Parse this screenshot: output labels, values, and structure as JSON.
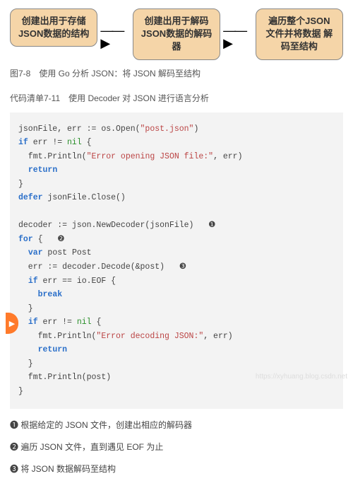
{
  "diagram": {
    "box1": "创建出用于存储\nJSON数据的结构",
    "box2": "创建出用于解码\nJSON数据的解码器",
    "box3": "遍历整个JSON\n文件并将数据\n解码至结构"
  },
  "caption": "图7-8　使用 Go 分析 JSON：将 JSON 解码至结构",
  "listing_title": "代码清单7-11　使用 Decoder 对 JSON 进行语言分析",
  "code": {
    "l1a": "jsonFile, err := os.Open(",
    "l1b": "\"post.json\"",
    "l1c": ")",
    "l2a": "if",
    "l2b": " err != ",
    "l2c": "nil",
    "l2d": " {",
    "l3a": "  fmt.Println(",
    "l3b": "\"Error opening JSON file:\"",
    "l3c": ", err)",
    "l4a": "  ",
    "l4b": "return",
    "l5": "}",
    "l6a": "defer",
    "l6b": " jsonFile.Close()",
    "blank1": "",
    "l7": "decoder := json.NewDecoder(jsonFile)   ❶",
    "l8a": "for",
    "l8b": " {   ❷",
    "l9a": "  ",
    "l9b": "var",
    "l9c": " post Post",
    "l10": "  err := decoder.Decode(&post)   ❸",
    "l11a": "  ",
    "l11b": "if",
    "l11c": " err == io.EOF {",
    "l12a": "    ",
    "l12b": "break",
    "l13": "  }",
    "l14a": "  ",
    "l14b": "if",
    "l14c": " err != ",
    "l14d": "nil",
    "l14e": " {",
    "l15a": "    fmt.Println(",
    "l15b": "\"Error decoding JSON:\"",
    "l15c": ", err)",
    "l16a": "    ",
    "l16b": "return",
    "l17": "  }",
    "l18": "  fmt.Println(post)",
    "l19": "}"
  },
  "notes": {
    "n1": "❶ 根据给定的 JSON 文件，创建出相应的解码器",
    "n2": "❷ 遍历 JSON 文件，直到遇见 EOF 为止",
    "n3": "❸ 将 JSON 数据解码至结构"
  },
  "watermark": "https://xyhuang.blog.csdn.net"
}
